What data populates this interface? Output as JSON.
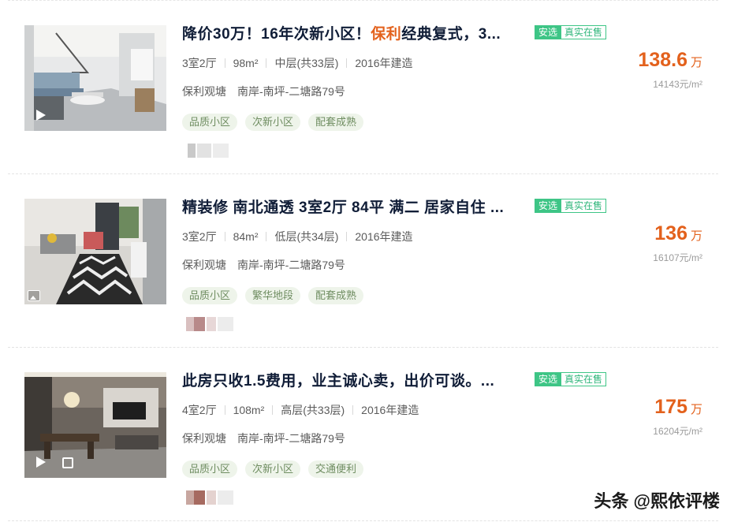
{
  "listings": [
    {
      "title_pre": "降价30万！16年次新小区！",
      "title_hl": "保利",
      "title_post": "经典复式，3...",
      "tag_safe": "安选",
      "tag_real": "真实在售",
      "layout": "3室2厅",
      "area": "98m²",
      "floor": "中层(共33层)",
      "year": "2016年建造",
      "community": "保利观塘",
      "location": "南岸-南坪-二塘路79号",
      "chips": [
        "品质小区",
        "次新小区",
        "配套成熟"
      ],
      "price": "138.6",
      "price_unit": "万",
      "unit_price": "14143元/m²",
      "thumb_icon": "play-icon"
    },
    {
      "title_pre": "精装修 南北通透 3室2厅 84平 满二 居家自住 ...",
      "title_hl": "",
      "title_post": "",
      "tag_safe": "安选",
      "tag_real": "真实在售",
      "layout": "3室2厅",
      "area": "84m²",
      "floor": "低层(共34层)",
      "year": "2016年建造",
      "community": "保利观塘",
      "location": "南岸-南坪-二塘路79号",
      "chips": [
        "品质小区",
        "繁华地段",
        "配套成熟"
      ],
      "price": "136",
      "price_unit": "万",
      "unit_price": "16107元/m²",
      "thumb_icon": "gallery-icon"
    },
    {
      "title_pre": "此房只收1.5费用，业主诚心卖，出价可谈。...",
      "title_hl": "",
      "title_post": "",
      "tag_safe": "安选",
      "tag_real": "真实在售",
      "layout": "4室2厅",
      "area": "108m²",
      "floor": "高层(共33层)",
      "year": "2016年建造",
      "community": "保利观塘",
      "location": "南岸-南坪-二塘路79号",
      "chips": [
        "品质小区",
        "次新小区",
        "交通便利"
      ],
      "price": "175",
      "price_unit": "万",
      "unit_price": "16204元/m²",
      "thumb_icon": "play-icon"
    }
  ],
  "watermark": "头条 @熙依评楼",
  "colors": {
    "accent": "#e3611c",
    "tag_green": "#3ec586",
    "chip_bg": "#eef4ea"
  }
}
